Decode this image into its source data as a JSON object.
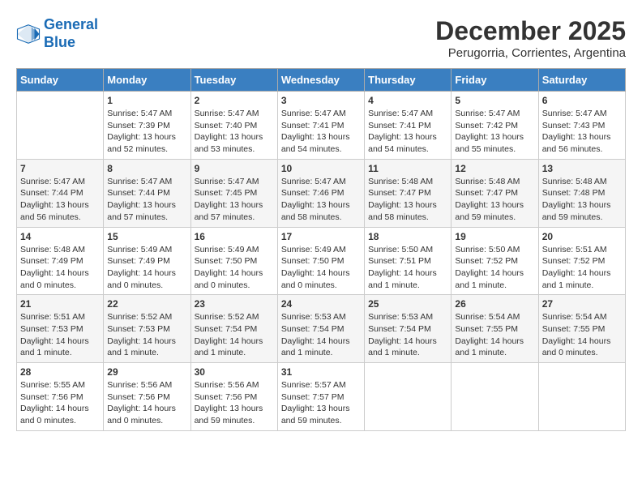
{
  "header": {
    "logo_line1": "General",
    "logo_line2": "Blue",
    "title": "December 2025",
    "subtitle": "Perugorria, Corrientes, Argentina"
  },
  "weekdays": [
    "Sunday",
    "Monday",
    "Tuesday",
    "Wednesday",
    "Thursday",
    "Friday",
    "Saturday"
  ],
  "weeks": [
    [
      {
        "day": "",
        "info": ""
      },
      {
        "day": "1",
        "info": "Sunrise: 5:47 AM\nSunset: 7:39 PM\nDaylight: 13 hours\nand 52 minutes."
      },
      {
        "day": "2",
        "info": "Sunrise: 5:47 AM\nSunset: 7:40 PM\nDaylight: 13 hours\nand 53 minutes."
      },
      {
        "day": "3",
        "info": "Sunrise: 5:47 AM\nSunset: 7:41 PM\nDaylight: 13 hours\nand 54 minutes."
      },
      {
        "day": "4",
        "info": "Sunrise: 5:47 AM\nSunset: 7:41 PM\nDaylight: 13 hours\nand 54 minutes."
      },
      {
        "day": "5",
        "info": "Sunrise: 5:47 AM\nSunset: 7:42 PM\nDaylight: 13 hours\nand 55 minutes."
      },
      {
        "day": "6",
        "info": "Sunrise: 5:47 AM\nSunset: 7:43 PM\nDaylight: 13 hours\nand 56 minutes."
      }
    ],
    [
      {
        "day": "7",
        "info": "Sunrise: 5:47 AM\nSunset: 7:44 PM\nDaylight: 13 hours\nand 56 minutes."
      },
      {
        "day": "8",
        "info": "Sunrise: 5:47 AM\nSunset: 7:44 PM\nDaylight: 13 hours\nand 57 minutes."
      },
      {
        "day": "9",
        "info": "Sunrise: 5:47 AM\nSunset: 7:45 PM\nDaylight: 13 hours\nand 57 minutes."
      },
      {
        "day": "10",
        "info": "Sunrise: 5:47 AM\nSunset: 7:46 PM\nDaylight: 13 hours\nand 58 minutes."
      },
      {
        "day": "11",
        "info": "Sunrise: 5:48 AM\nSunset: 7:47 PM\nDaylight: 13 hours\nand 58 minutes."
      },
      {
        "day": "12",
        "info": "Sunrise: 5:48 AM\nSunset: 7:47 PM\nDaylight: 13 hours\nand 59 minutes."
      },
      {
        "day": "13",
        "info": "Sunrise: 5:48 AM\nSunset: 7:48 PM\nDaylight: 13 hours\nand 59 minutes."
      }
    ],
    [
      {
        "day": "14",
        "info": "Sunrise: 5:48 AM\nSunset: 7:49 PM\nDaylight: 14 hours\nand 0 minutes."
      },
      {
        "day": "15",
        "info": "Sunrise: 5:49 AM\nSunset: 7:49 PM\nDaylight: 14 hours\nand 0 minutes."
      },
      {
        "day": "16",
        "info": "Sunrise: 5:49 AM\nSunset: 7:50 PM\nDaylight: 14 hours\nand 0 minutes."
      },
      {
        "day": "17",
        "info": "Sunrise: 5:49 AM\nSunset: 7:50 PM\nDaylight: 14 hours\nand 0 minutes."
      },
      {
        "day": "18",
        "info": "Sunrise: 5:50 AM\nSunset: 7:51 PM\nDaylight: 14 hours\nand 1 minute."
      },
      {
        "day": "19",
        "info": "Sunrise: 5:50 AM\nSunset: 7:52 PM\nDaylight: 14 hours\nand 1 minute."
      },
      {
        "day": "20",
        "info": "Sunrise: 5:51 AM\nSunset: 7:52 PM\nDaylight: 14 hours\nand 1 minute."
      }
    ],
    [
      {
        "day": "21",
        "info": "Sunrise: 5:51 AM\nSunset: 7:53 PM\nDaylight: 14 hours\nand 1 minute."
      },
      {
        "day": "22",
        "info": "Sunrise: 5:52 AM\nSunset: 7:53 PM\nDaylight: 14 hours\nand 1 minute."
      },
      {
        "day": "23",
        "info": "Sunrise: 5:52 AM\nSunset: 7:54 PM\nDaylight: 14 hours\nand 1 minute."
      },
      {
        "day": "24",
        "info": "Sunrise: 5:53 AM\nSunset: 7:54 PM\nDaylight: 14 hours\nand 1 minute."
      },
      {
        "day": "25",
        "info": "Sunrise: 5:53 AM\nSunset: 7:54 PM\nDaylight: 14 hours\nand 1 minute."
      },
      {
        "day": "26",
        "info": "Sunrise: 5:54 AM\nSunset: 7:55 PM\nDaylight: 14 hours\nand 1 minute."
      },
      {
        "day": "27",
        "info": "Sunrise: 5:54 AM\nSunset: 7:55 PM\nDaylight: 14 hours\nand 0 minutes."
      }
    ],
    [
      {
        "day": "28",
        "info": "Sunrise: 5:55 AM\nSunset: 7:56 PM\nDaylight: 14 hours\nand 0 minutes."
      },
      {
        "day": "29",
        "info": "Sunrise: 5:56 AM\nSunset: 7:56 PM\nDaylight: 14 hours\nand 0 minutes."
      },
      {
        "day": "30",
        "info": "Sunrise: 5:56 AM\nSunset: 7:56 PM\nDaylight: 13 hours\nand 59 minutes."
      },
      {
        "day": "31",
        "info": "Sunrise: 5:57 AM\nSunset: 7:57 PM\nDaylight: 13 hours\nand 59 minutes."
      },
      {
        "day": "",
        "info": ""
      },
      {
        "day": "",
        "info": ""
      },
      {
        "day": "",
        "info": ""
      }
    ]
  ]
}
